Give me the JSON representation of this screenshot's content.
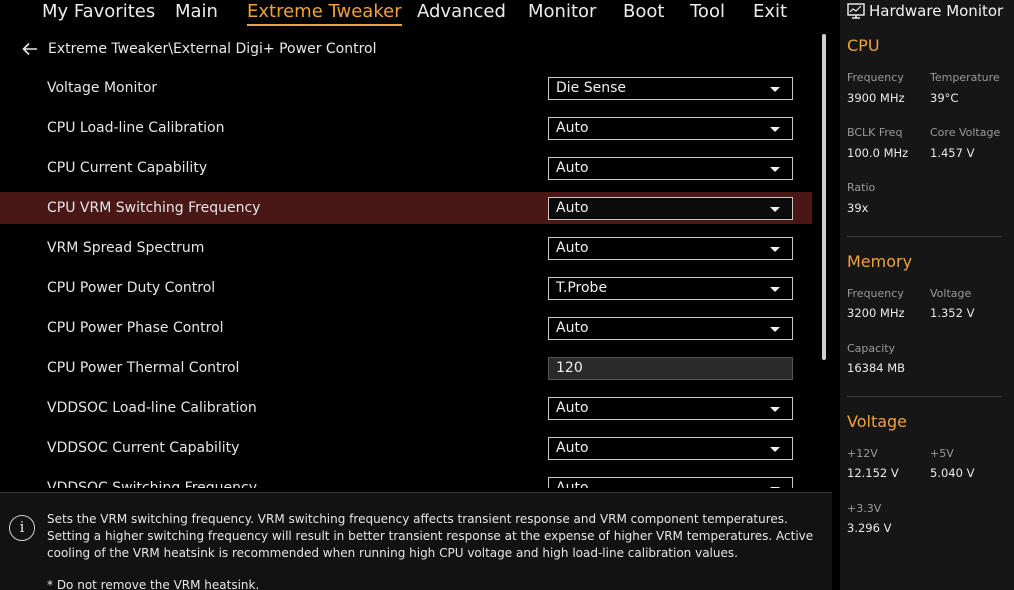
{
  "nav": {
    "tabs": [
      {
        "label": "My Favorites"
      },
      {
        "label": "Main"
      },
      {
        "label": "Extreme Tweaker",
        "active": true
      },
      {
        "label": "Advanced"
      },
      {
        "label": "Monitor"
      },
      {
        "label": "Boot"
      },
      {
        "label": "Tool"
      },
      {
        "label": "Exit"
      }
    ]
  },
  "breadcrumb": "Extreme Tweaker\\External Digi+ Power Control",
  "settings": [
    {
      "label": "Voltage Monitor",
      "value": "Die Sense",
      "type": "dropdown"
    },
    {
      "label": "CPU Load-line Calibration",
      "value": "Auto",
      "type": "dropdown"
    },
    {
      "label": "CPU Current Capability",
      "value": "Auto",
      "type": "dropdown"
    },
    {
      "label": "CPU VRM Switching Frequency",
      "value": "Auto",
      "type": "dropdown",
      "selected": true
    },
    {
      "label": "VRM Spread Spectrum",
      "value": "Auto",
      "type": "dropdown"
    },
    {
      "label": "CPU Power Duty Control",
      "value": "T.Probe",
      "type": "dropdown"
    },
    {
      "label": "CPU Power Phase Control",
      "value": "Auto",
      "type": "dropdown"
    },
    {
      "label": "CPU Power Thermal Control",
      "value": "120",
      "type": "input"
    },
    {
      "label": "VDDSOC Load-line Calibration",
      "value": "Auto",
      "type": "dropdown"
    },
    {
      "label": "VDDSOC Current Capability",
      "value": "Auto",
      "type": "dropdown"
    },
    {
      "label": "VDDSOC Switching Frequency",
      "value": "Auto",
      "type": "dropdown"
    }
  ],
  "help": {
    "text": "Sets the VRM switching frequency.  VRM switching frequency affects transient response and VRM component temperatures. Setting a higher switching frequency will result in better transient response at the expense of higher VRM temperatures. Active cooling of the VRM heatsink is recommended when running high CPU voltage and high load-line calibration values.",
    "note": "* Do not remove the VRM heatsink."
  },
  "hardware_monitor": {
    "title": "Hardware Monitor",
    "cpu": {
      "title": "CPU",
      "frequency_label": "Frequency",
      "frequency": "3900 MHz",
      "temperature_label": "Temperature",
      "temperature": "39°C",
      "bclk_label": "BCLK Freq",
      "bclk": "100.0 MHz",
      "core_voltage_label": "Core Voltage",
      "core_voltage": "1.457 V",
      "ratio_label": "Ratio",
      "ratio": "39x"
    },
    "memory": {
      "title": "Memory",
      "frequency_label": "Frequency",
      "frequency": "3200 MHz",
      "voltage_label": "Voltage",
      "voltage": "1.352 V",
      "capacity_label": "Capacity",
      "capacity": "16384 MB"
    },
    "voltage": {
      "title": "Voltage",
      "v12_label": "+12V",
      "v12": "12.152 V",
      "v5_label": "+5V",
      "v5": "5.040 V",
      "v33_label": "+3.3V",
      "v33": "3.296 V"
    }
  },
  "colors": {
    "accent": "#f0a33a",
    "selected_row": "#4a1717",
    "panel_bg": "#161616"
  }
}
